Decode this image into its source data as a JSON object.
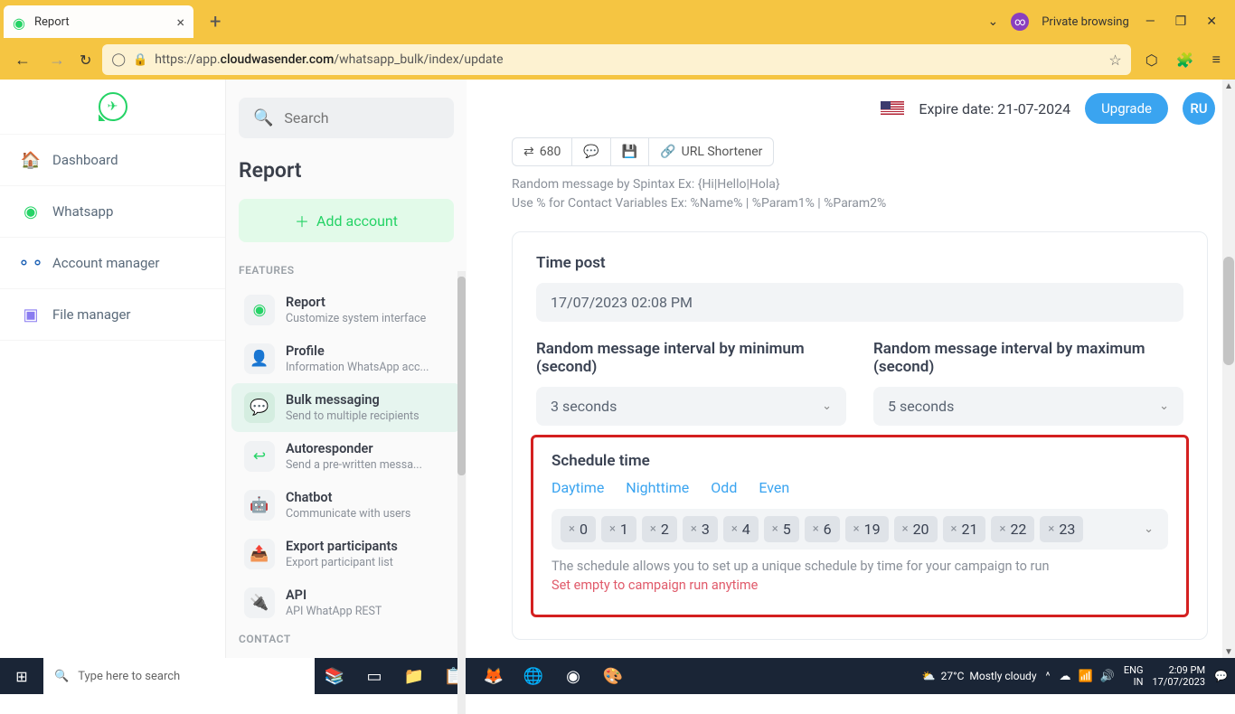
{
  "browser": {
    "tab_title": "Report",
    "private_text": "Private browsing",
    "url_prefix": "https://app.",
    "url_bold": "cloudwasender.com",
    "url_suffix": "/whatsapp_bulk/index/update"
  },
  "sidebar": {
    "items": [
      {
        "label": "Dashboard"
      },
      {
        "label": "Whatsapp"
      },
      {
        "label": "Account manager"
      },
      {
        "label": "File manager"
      }
    ]
  },
  "panel": {
    "search_placeholder": "Search",
    "title": "Report",
    "add_account": "Add account",
    "section_features": "FEATURES",
    "section_contact": "CONTACT",
    "features": [
      {
        "title": "Report",
        "sub": "Customize system interface"
      },
      {
        "title": "Profile",
        "sub": "Information WhatsApp acc..."
      },
      {
        "title": "Bulk messaging",
        "sub": "Send to multiple recipients"
      },
      {
        "title": "Autoresponder",
        "sub": "Send a pre-written messa..."
      },
      {
        "title": "Chatbot",
        "sub": "Communicate with users"
      },
      {
        "title": "Export participants",
        "sub": "Export participant list"
      },
      {
        "title": "API",
        "sub": "API WhatApp REST"
      }
    ]
  },
  "header": {
    "expire": "Expire date: 21-07-2024",
    "upgrade": "Upgrade",
    "avatar": "RU"
  },
  "toolbar": {
    "count": "680",
    "url_shortener": "URL Shortener"
  },
  "help": {
    "line1": "Random message by Spintax Ex: {Hi|Hello|Hola}",
    "line2": "Use % for Contact Variables Ex: %Name% | %Param1% | %Param2%"
  },
  "form": {
    "time_post_label": "Time post",
    "time_post_value": "17/07/2023 02:08 PM",
    "min_label": "Random message interval by minimum (second)",
    "min_value": "3 seconds",
    "max_label": "Random message interval by maximum (second)",
    "max_value": "5 seconds",
    "schedule_label": "Schedule time",
    "presets": [
      "Daytime",
      "Nighttime",
      "Odd",
      "Even"
    ],
    "tags": [
      "0",
      "1",
      "2",
      "3",
      "4",
      "5",
      "6",
      "19",
      "20",
      "21",
      "22",
      "23"
    ],
    "hint1": "The schedule allows you to set up a unique schedule by time for your campaign to run",
    "hint2": "Set empty to campaign run anytime"
  },
  "taskbar": {
    "search_placeholder": "Type here to search",
    "weather_temp": "27°C",
    "weather_text": "Mostly cloudy",
    "lang": "ENG",
    "region": "IN",
    "time": "2:09 PM",
    "date": "17/07/2023"
  }
}
